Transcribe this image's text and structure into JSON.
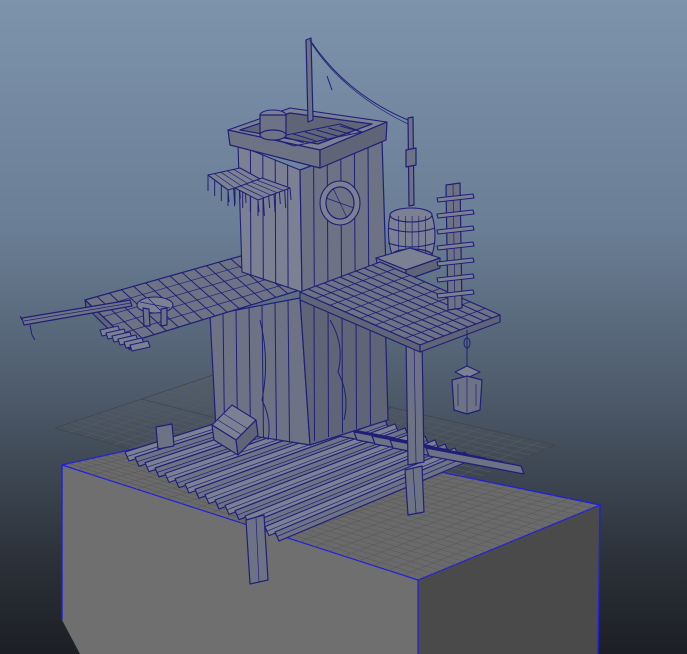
{
  "app": {
    "view": "perspective-viewport",
    "selection_highlight_color": "#1f1fe0",
    "wireframe_color": "#1e1f78",
    "shaded_color": "#6d7384",
    "background_top_color": "#7d93ac",
    "background_bottom_color": "#1c1f24"
  },
  "scene": {
    "objects": [
      {
        "name": "ground-box",
        "selected": true
      },
      {
        "name": "grid-plane"
      },
      {
        "name": "tower"
      },
      {
        "name": "roof-hatch"
      },
      {
        "name": "awnings"
      },
      {
        "name": "porthole-window"
      },
      {
        "name": "flag-pole"
      },
      {
        "name": "lantern-pole"
      },
      {
        "name": "barrel"
      },
      {
        "name": "ladder-post"
      },
      {
        "name": "upper-deck"
      },
      {
        "name": "lower-dock"
      },
      {
        "name": "beam"
      },
      {
        "name": "stool"
      },
      {
        "name": "hanging-lantern"
      },
      {
        "name": "crate"
      },
      {
        "name": "support-posts"
      }
    ]
  }
}
